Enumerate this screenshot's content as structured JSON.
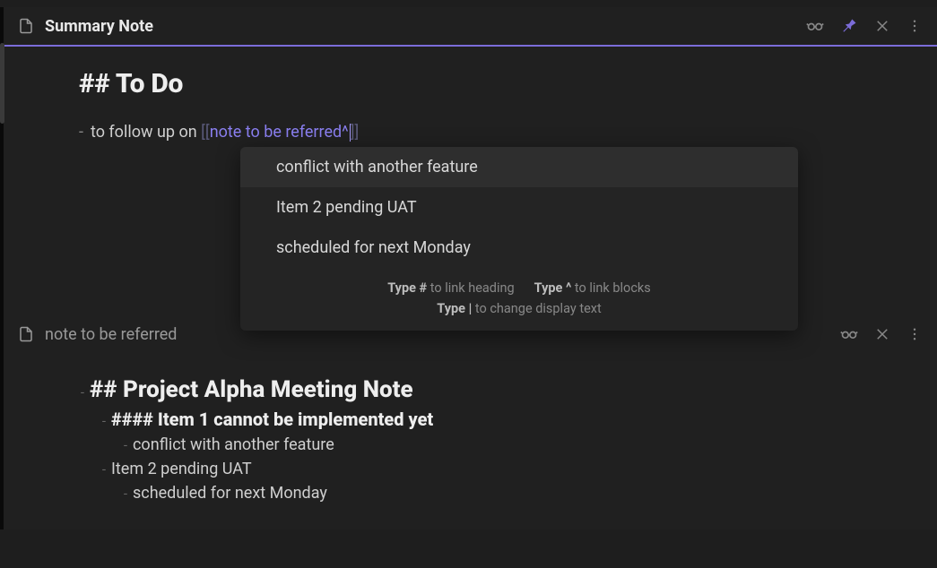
{
  "pane1": {
    "title": "Summary Note",
    "heading": "## To Do",
    "bullet_prefix": "-",
    "bullet_text": "to follow up on ",
    "link_open": "[[",
    "link_body": "note to be referred^",
    "link_close": "]]"
  },
  "autocomplete": {
    "items": [
      "conflict with another feature",
      "Item 2 pending UAT",
      "scheduled for next Monday"
    ],
    "hint_hash_b": "Type #",
    "hint_hash_t": " to link heading",
    "hint_caret_b": "Type ^",
    "hint_caret_t": " to link blocks",
    "hint_pipe_b": "Type |",
    "hint_pipe_t": " to change display text"
  },
  "pane2": {
    "title": "note to be referred",
    "h2": "## Project Alpha Meeting Note",
    "h4": "#### Item 1 cannot be implemented yet",
    "line1": "conflict with another feature",
    "line2": "Item 2 pending UAT",
    "line3": "scheduled for next Monday"
  }
}
